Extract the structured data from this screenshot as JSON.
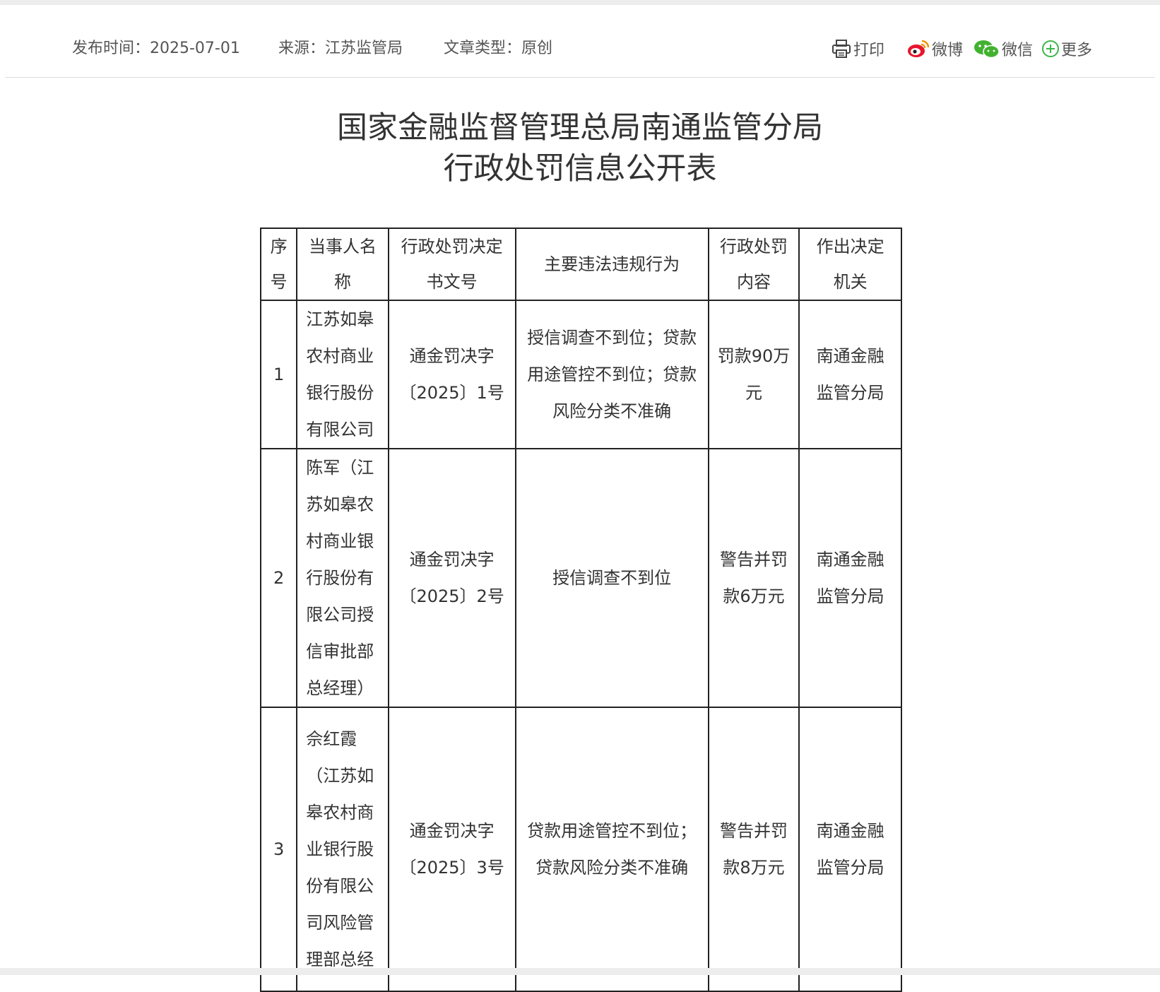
{
  "meta": {
    "publish_time": "发布时间：2025-07-01",
    "source": "来源：江苏监管局",
    "article_type": "文章类型：原创"
  },
  "share": {
    "print": "打印",
    "weibo": "微博",
    "wechat": "微信",
    "more": "更多",
    "weibo_color": "#e6162d",
    "wechat_color": "#43b130",
    "more_color": "#3bb64a"
  },
  "title": {
    "line1": "国家金融监督管理总局南通监管分局",
    "line2": "行政处罚信息公开表"
  },
  "table": {
    "headers": [
      "序号",
      "当事人名称",
      "行政处罚决定书文号",
      "主要违法违规行为",
      "行政处罚内容",
      "作出决定机关"
    ],
    "rows": [
      {
        "no": "1",
        "party": "江苏如皋农村商业银行股份有限公司",
        "doc_no": "通金罚决字〔2025〕1号",
        "violation": "授信调查不到位；贷款用途管控不到位；贷款风险分类不准确",
        "penalty": "罚款90万元",
        "authority": "南通金融监管分局"
      },
      {
        "no": "2",
        "party": "陈军（江苏如皋农村商业银行股份有限公司授信审批部总经理）",
        "doc_no": "通金罚决字〔2025〕2号",
        "violation": "授信调查不到位",
        "penalty": "警告并罚款6万元",
        "authority": "南通金融监管分局"
      },
      {
        "no": "3",
        "party": "佘红霞（江苏如皋农村商业银行股份有限公司风险管理部总经",
        "doc_no": "通金罚决字〔2025〕3号",
        "violation": "贷款用途管控不到位；贷款风险分类不准确",
        "penalty": "警告并罚款8万元",
        "authority": "南通金融监管分局"
      }
    ]
  }
}
